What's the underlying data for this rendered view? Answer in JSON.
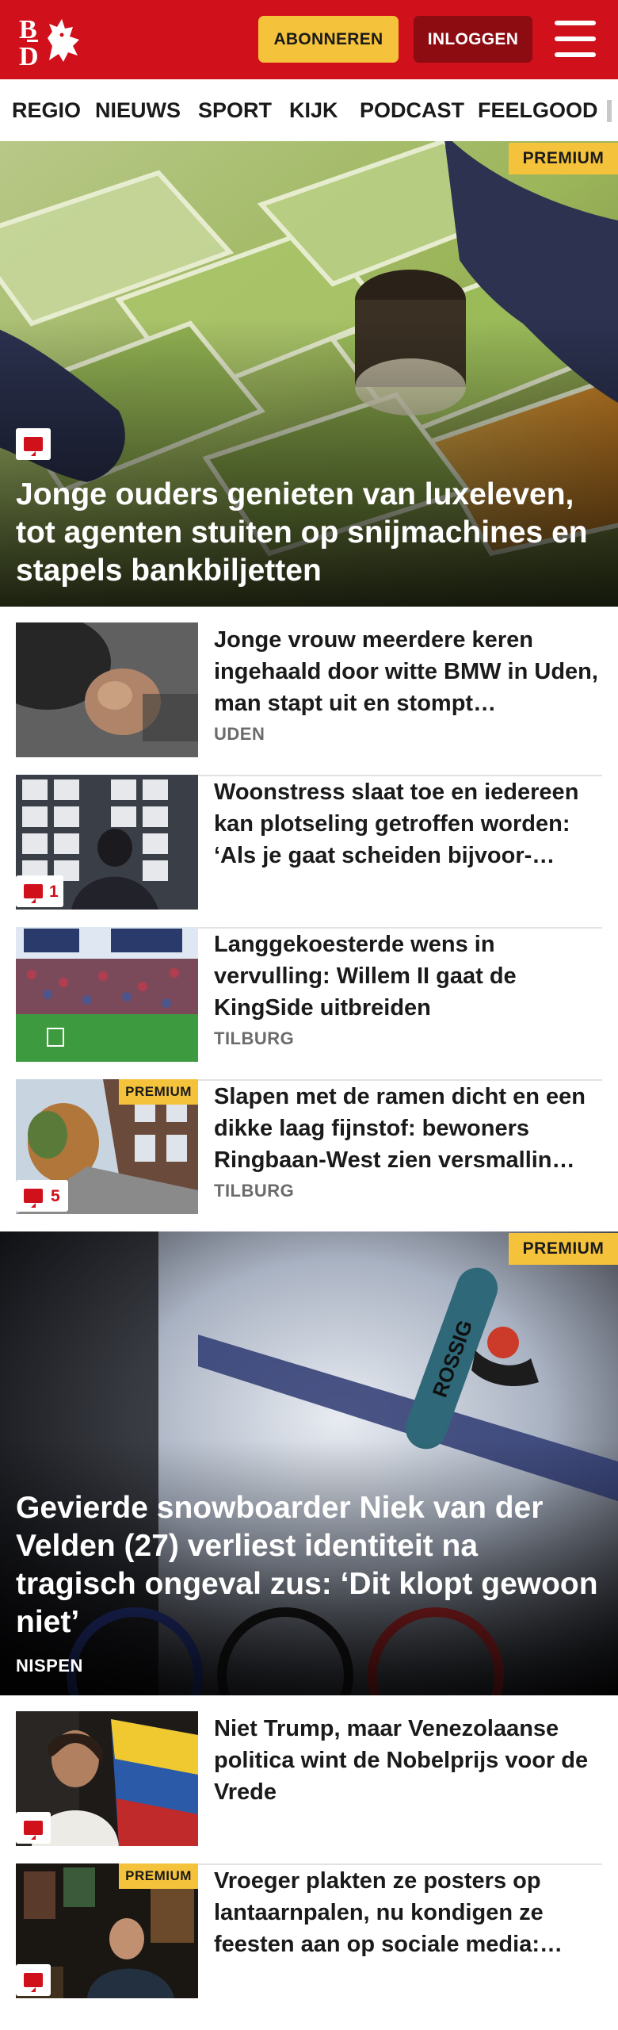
{
  "header": {
    "logo_text": "BD",
    "subscribe_label": "ABONNEREN",
    "login_label": "INLOGGEN",
    "brand_color": "#d0101b"
  },
  "nav": {
    "items": [
      "REGIO",
      "NIEUWS",
      "SPORT",
      "KIJK",
      "PODCAST",
      "FEELGOOD"
    ]
  },
  "hero1": {
    "badge": "PREMIUM",
    "title": "Jonge ouders genieten van luxeleven, tot agenten stuiten op snijmachines en stapels bankbiljetten",
    "icon": "comment-icon"
  },
  "articles1": [
    {
      "title": "Jonge vrouw meerdere keren ingehaald door witte BMW in Uden, man stapt uit en stompt…",
      "location": "UDEN",
      "comments": "",
      "badge": ""
    },
    {
      "title": "Woonstress slaat toe en iedereen kan plotseling getroffen worden: ‘Als je gaat scheiden bijvoor-…",
      "location": "",
      "comments": "1",
      "badge": ""
    },
    {
      "title": "Langgekoesterde wens in vervulling: Willem II gaat de KingSide uitbreiden",
      "location": "TILBURG",
      "comments": "",
      "badge": ""
    },
    {
      "title": "Slapen met de ramen dicht en een dikke laag fijnstof: bewoners Ringbaan-West zien versmallin…",
      "location": "TILBURG",
      "comments": "5",
      "badge": "PREMIUM"
    }
  ],
  "hero2": {
    "badge": "PREMIUM",
    "title": "Gevierde snowboarder Niek van der Velden (27) verliest identiteit na tragisch ongeval zus: ‘Dit klopt gewoon niet’",
    "location": "NISPEN",
    "board_text": "ROSSIG"
  },
  "articles2": [
    {
      "title": "Niet Trump, maar Venezolaanse politica wint de Nobelprijs voor de Vrede",
      "location": "",
      "comments": "",
      "badge": ""
    },
    {
      "title": "Vroeger plakten ze posters op lantaarnpalen, nu kondigen ze feesten aan op sociale media:…",
      "location": "",
      "comments": "",
      "badge": "PREMIUM"
    }
  ]
}
